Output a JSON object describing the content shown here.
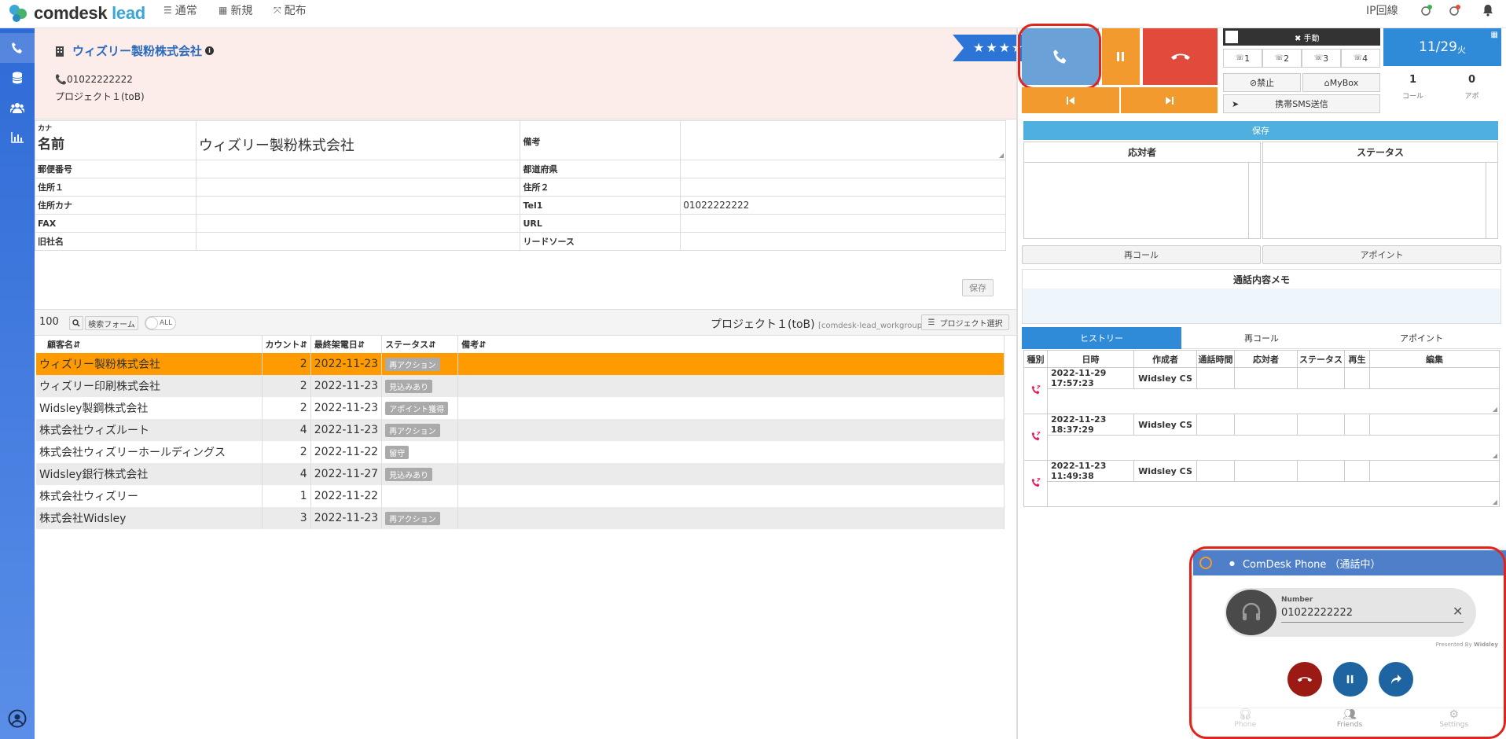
{
  "app": {
    "logo_main": "comdesk",
    "logo_accent": "lead"
  },
  "nav": [
    {
      "icon": "list-icon",
      "label": "通常"
    },
    {
      "icon": "grid-icon",
      "label": "新規"
    },
    {
      "icon": "arrows-icon",
      "label": "配布"
    }
  ],
  "top_right": {
    "line_label": "IP回線"
  },
  "header": {
    "company": "ウィズリー製粉株式会社",
    "phone": "📞01022222222",
    "project": "プロジェクト１(toB)",
    "stars": "★★★★★"
  },
  "form": {
    "kana_label": "カナ",
    "name_label": "名前",
    "name_value": "ウィズリー製粉株式会社",
    "note_label": "備考",
    "rows": [
      {
        "l1": "郵便番号",
        "v1": "",
        "l2": "都道府県",
        "v2": ""
      },
      {
        "l1": "住所１",
        "v1": "",
        "l2": "住所２",
        "v2": ""
      },
      {
        "l1": "住所カナ",
        "v1": "",
        "l2": "Tel1",
        "v2": "01022222222"
      },
      {
        "l1": "FAX",
        "v1": "",
        "l2": "URL",
        "v2": ""
      },
      {
        "l1": "旧社名",
        "v1": "",
        "l2": "リードソース",
        "v2": ""
      }
    ],
    "save": "保存"
  },
  "list": {
    "count": "100",
    "search_btn": "検索フォーム",
    "toggle": "ALL",
    "project": "プロジェクト１(toB)",
    "workgroup": "[comdesk-lead_workgroup]",
    "project_btn": "プロジェクト選択",
    "headers": [
      "顧客名⇵",
      "カウント⇵",
      "最終架電日⇵",
      "ステータス⇵",
      "備考⇵"
    ],
    "rows": [
      {
        "name": "ウィズリー製粉株式会社",
        "count": "2",
        "date": "2022-11-23",
        "status": "再アクション"
      },
      {
        "name": "ウィズリー印刷株式会社",
        "count": "2",
        "date": "2022-11-23",
        "status": "見込みあり"
      },
      {
        "name": "Widsley製鋼株式会社",
        "count": "2",
        "date": "2022-11-23",
        "status": "アポイント獲得"
      },
      {
        "name": "株式会社ウィズルート",
        "count": "4",
        "date": "2022-11-23",
        "status": "再アクション"
      },
      {
        "name": "株式会社ウィズリーホールディングス",
        "count": "2",
        "date": "2022-11-22",
        "status": "留守"
      },
      {
        "name": "Widsley銀行株式会社",
        "count": "4",
        "date": "2022-11-27",
        "status": "見込みあり"
      },
      {
        "name": "株式会社ウィズリー",
        "count": "1",
        "date": "2022-11-22",
        "status": ""
      },
      {
        "name": "株式会社Widsley",
        "count": "3",
        "date": "2022-11-23",
        "status": "再アクション"
      }
    ]
  },
  "controls": {
    "manual": "✖ 手動",
    "lines": [
      "1",
      "2",
      "3",
      "4"
    ],
    "block": "⊘禁止",
    "mybox": "⌂MyBox",
    "sms": "携帯SMS送信",
    "date": "11/29",
    "weekday": "火",
    "call_count": "1",
    "call_label": "コール",
    "apo_count": "0",
    "apo_label": "アポ",
    "save": "保存",
    "responder": "応対者",
    "status": "ステータス",
    "recall": "再コール",
    "appoint": "アポイント",
    "memo": "通話内容メモ"
  },
  "history": {
    "tabs": [
      "ヒストリー",
      "再コール",
      "アポイント"
    ],
    "headers": [
      "種別",
      "日時",
      "作成者",
      "通話時間",
      "応対者",
      "ステータス",
      "再生",
      "編集"
    ],
    "rows": [
      {
        "date": "2022-11-29 17:57:23",
        "author": "Widsley CS"
      },
      {
        "date": "2022-11-23 18:37:29",
        "author": "Widsley CS"
      },
      {
        "date": "2022-11-23 11:49:38",
        "author": "Widsley CS"
      }
    ]
  },
  "phone": {
    "title": "ComDesk Phone （通話中）",
    "number_label": "Number",
    "number": "01022222222",
    "presented": "Presented By",
    "brand": "Widsley",
    "tabs": [
      "Phone",
      "Friends",
      "Settings"
    ]
  },
  "colors": {
    "blue": "#2f6bd6",
    "orange": "#f29a2e",
    "red": "#e14b3b",
    "highlight": "#ff9b00"
  }
}
